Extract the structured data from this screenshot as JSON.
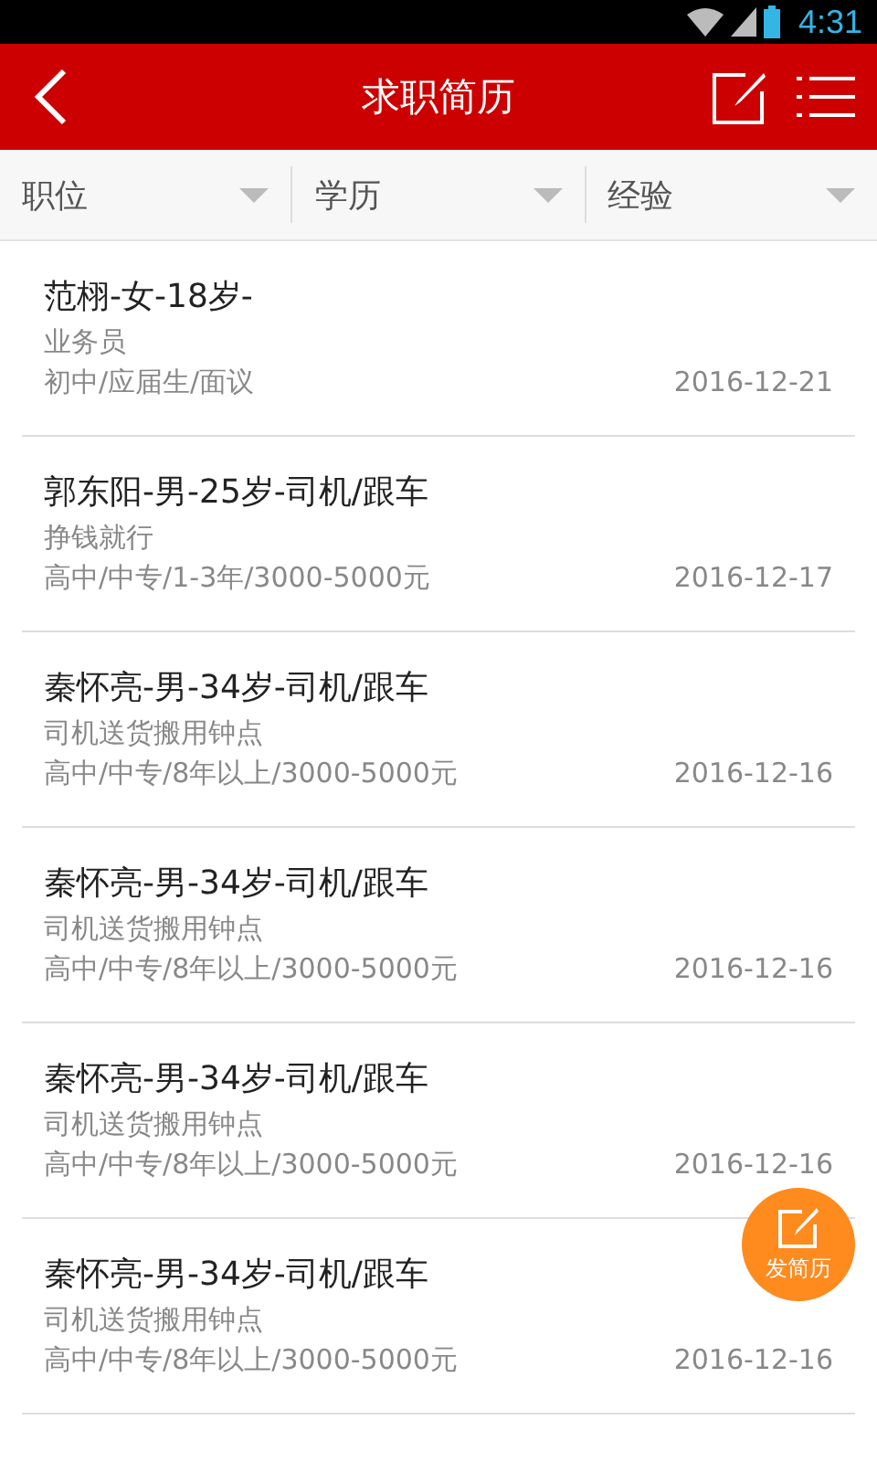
{
  "status_bar": {
    "time": "4:31"
  },
  "header": {
    "title": "求职简历"
  },
  "filters": [
    {
      "label": "职位"
    },
    {
      "label": "学历"
    },
    {
      "label": "经验"
    }
  ],
  "resumes": [
    {
      "title": "范栩-女-18岁-",
      "subtitle": "业务员",
      "details": "初中/应届生/面议",
      "date": "2016-12-21"
    },
    {
      "title": "郭东阳-男-25岁-司机/跟车",
      "subtitle": "挣钱就行",
      "details": "高中/中专/1-3年/3000-5000元",
      "date": "2016-12-17"
    },
    {
      "title": "秦怀亮-男-34岁-司机/跟车",
      "subtitle": "司机送货搬用钟点",
      "details": "高中/中专/8年以上/3000-5000元",
      "date": "2016-12-16"
    },
    {
      "title": "秦怀亮-男-34岁-司机/跟车",
      "subtitle": "司机送货搬用钟点",
      "details": "高中/中专/8年以上/3000-5000元",
      "date": "2016-12-16"
    },
    {
      "title": "秦怀亮-男-34岁-司机/跟车",
      "subtitle": "司机送货搬用钟点",
      "details": "高中/中专/8年以上/3000-5000元",
      "date": "2016-12-16"
    },
    {
      "title": "秦怀亮-男-34岁-司机/跟车",
      "subtitle": "司机送货搬用钟点",
      "details": "高中/中专/8年以上/3000-5000元",
      "date": "2016-12-16"
    }
  ],
  "fab": {
    "label": "发简历"
  }
}
